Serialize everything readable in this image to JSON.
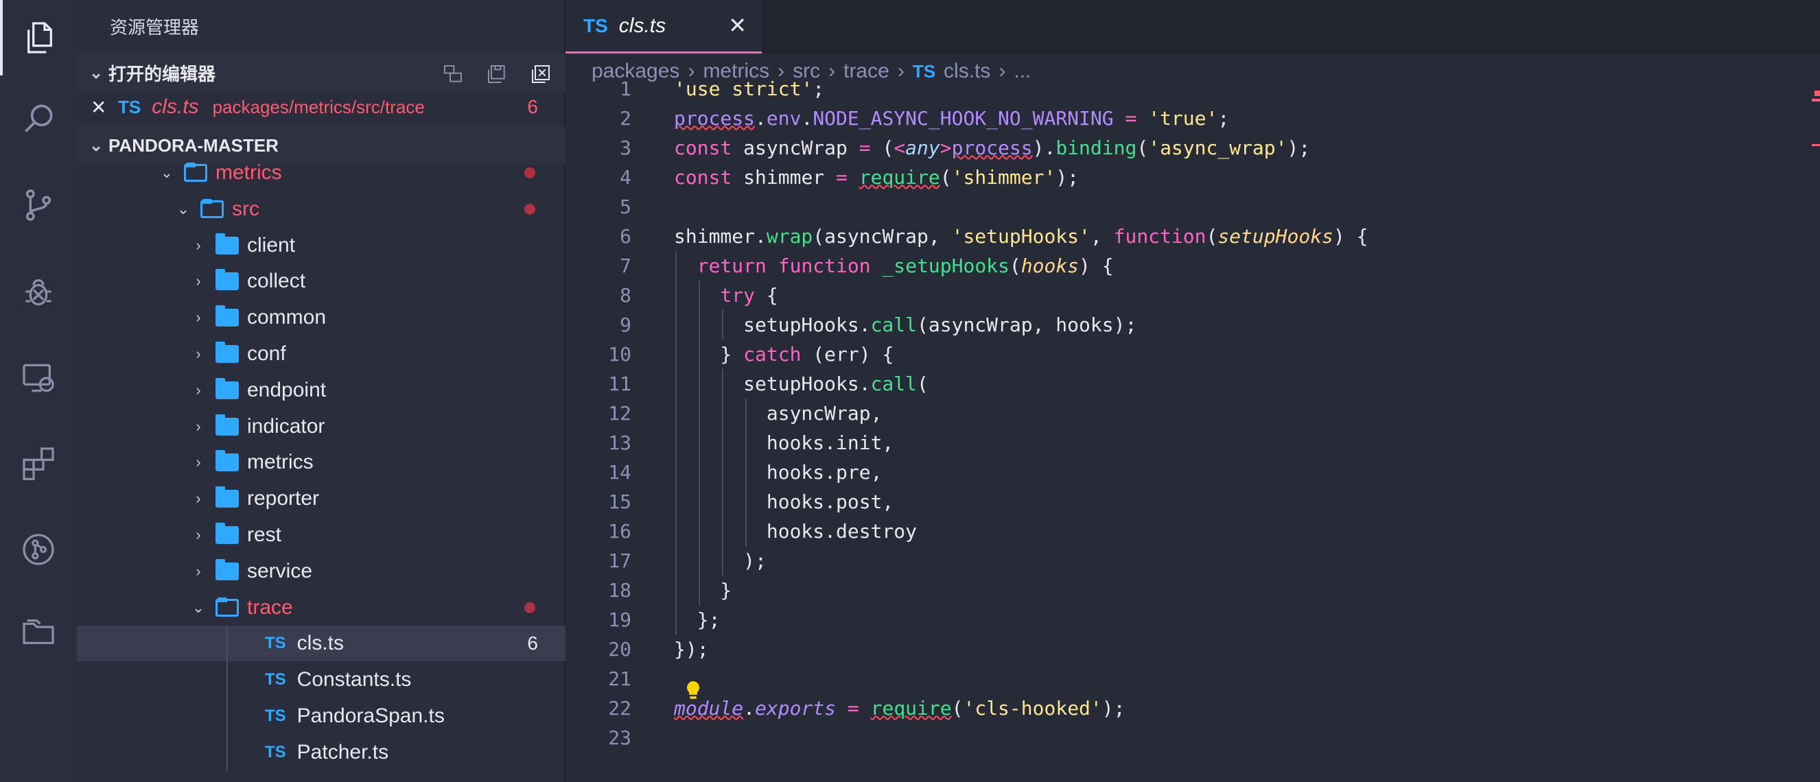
{
  "sidebar": {
    "title": "资源管理器",
    "open_editors_label": "打开的编辑器",
    "open_editor": {
      "close": "✕",
      "ts": "TS",
      "file": "cls.ts",
      "path": "packages/metrics/src/trace",
      "count": "6"
    },
    "workspace_label": "PANDORA-MASTER",
    "tree": [
      {
        "label": "metrics",
        "type": "folder-open",
        "level": 1,
        "color": "#ff5a6d",
        "dot": true
      },
      {
        "label": "src",
        "type": "folder-open",
        "level": 2,
        "color": "#ff5a6d",
        "dot": true
      },
      {
        "label": "client",
        "type": "folder",
        "level": 3
      },
      {
        "label": "collect",
        "type": "folder",
        "level": 3
      },
      {
        "label": "common",
        "type": "folder",
        "level": 3
      },
      {
        "label": "conf",
        "type": "folder",
        "level": 3
      },
      {
        "label": "endpoint",
        "type": "folder",
        "level": 3
      },
      {
        "label": "indicator",
        "type": "folder",
        "level": 3
      },
      {
        "label": "metrics",
        "type": "folder",
        "level": 3
      },
      {
        "label": "reporter",
        "type": "folder",
        "level": 3
      },
      {
        "label": "rest",
        "type": "folder",
        "level": 3
      },
      {
        "label": "service",
        "type": "folder",
        "level": 3
      },
      {
        "label": "trace",
        "type": "folder-open",
        "level": 3,
        "color": "#ff5a6d",
        "dot": true
      },
      {
        "label": "cls.ts",
        "type": "ts",
        "level": 4,
        "selected": true,
        "count": "6"
      },
      {
        "label": "Constants.ts",
        "type": "ts",
        "level": 4
      },
      {
        "label": "PandoraSpan.ts",
        "type": "ts",
        "level": 4
      },
      {
        "label": "Patcher.ts",
        "type": "ts",
        "level": 4
      }
    ]
  },
  "editor": {
    "tab": {
      "ts": "TS",
      "name": "cls.ts",
      "close": "✕"
    },
    "breadcrumb": [
      "packages",
      "metrics",
      "src",
      "trace",
      "cls.ts",
      "..."
    ],
    "breadcrumb_ts": "TS",
    "line_numbers": [
      "1",
      "2",
      "3",
      "4",
      "5",
      "6",
      "7",
      "8",
      "9",
      "10",
      "11",
      "12",
      "13",
      "14",
      "15",
      "16",
      "17",
      "18",
      "19",
      "20",
      "21",
      "22",
      "23"
    ]
  },
  "icons": [
    "files-icon",
    "search-icon",
    "source-control-icon",
    "debug-icon",
    "remote-explorer-icon",
    "extensions-icon",
    "git-graph-icon",
    "project-manager-icon"
  ]
}
